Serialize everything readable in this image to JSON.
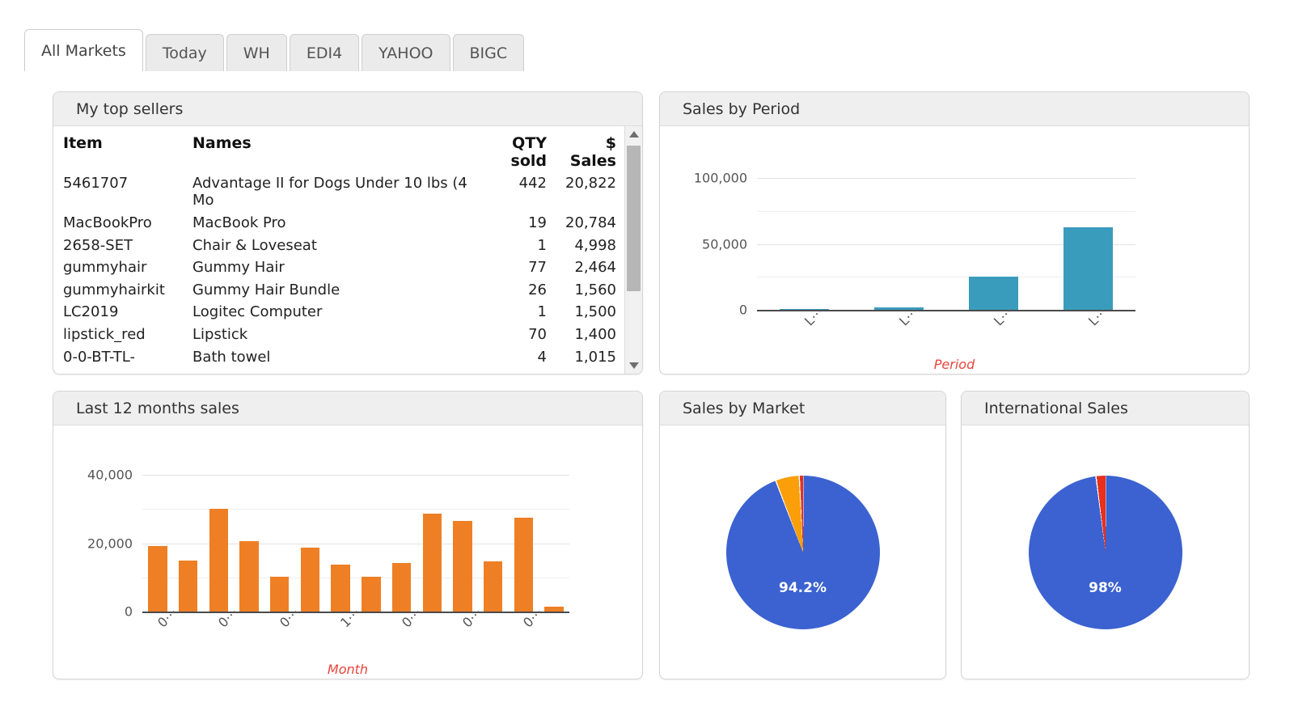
{
  "tabs": [
    {
      "label": "All Markets",
      "active": true
    },
    {
      "label": "Today",
      "active": false
    },
    {
      "label": "WH",
      "active": false
    },
    {
      "label": "EDI4",
      "active": false
    },
    {
      "label": "YAHOO",
      "active": false
    },
    {
      "label": "BIGC",
      "active": false
    }
  ],
  "panels": {
    "top_sellers": {
      "title": "My top sellers"
    },
    "sales_by_period": {
      "title": "Sales by Period"
    },
    "last_12_months": {
      "title": "Last 12 months sales"
    },
    "sales_by_market": {
      "title": "Sales by Market"
    },
    "international_sales": {
      "title": "International Sales"
    }
  },
  "top_sellers_table": {
    "columns": [
      "Item",
      "Names",
      "QTY sold",
      "$ Sales"
    ],
    "column_parts": {
      "qty_line1": "QTY",
      "qty_line2": "sold",
      "sales_line1": "$",
      "sales_line2": "Sales"
    },
    "rows": [
      {
        "item": "5461707",
        "name": "Advantage II for Dogs Under 10 lbs (4 Mo",
        "qty": "442",
        "sales": "20,822"
      },
      {
        "item": "MacBookPro",
        "name": "MacBook Pro",
        "qty": "19",
        "sales": "20,784"
      },
      {
        "item": "2658-SET",
        "name": "Chair & Loveseat",
        "qty": "1",
        "sales": "4,998"
      },
      {
        "item": "gummyhair",
        "name": "Gummy Hair",
        "qty": "77",
        "sales": "2,464"
      },
      {
        "item": "gummyhairkit",
        "name": "Gummy Hair Bundle",
        "qty": "26",
        "sales": "1,560"
      },
      {
        "item": "LC2019",
        "name": "Logitec Computer",
        "qty": "1",
        "sales": "1,500"
      },
      {
        "item": "lipstick_red",
        "name": "Lipstick",
        "qty": "70",
        "sales": "1,400"
      },
      {
        "item": "0-0-BT-TL-",
        "name": "Bath towel",
        "qty": "4",
        "sales": "1,015"
      }
    ],
    "scrollbar": {
      "up_icon": "triangle-up-icon",
      "down_icon": "triangle-down-icon"
    }
  },
  "colors": {
    "bar_teal": "#3a9cbc",
    "bar_orange": "#ef7f25",
    "pie_blue": "#3b62d0",
    "pie_orange": "#fa9e0a",
    "pie_red": "#e8301b",
    "axis_title": "#e8453c",
    "gridline": "#e3e3e3"
  },
  "chart_data": [
    {
      "id": "sales_by_period",
      "type": "bar",
      "title": "Sales by Period",
      "xlabel": "Period",
      "ylabel": "",
      "categories": [
        "L⋯",
        "L⋯",
        "L⋯",
        "L⋯"
      ],
      "values": [
        150,
        2100,
        25200,
        63000
      ],
      "yticks": [
        0,
        50000,
        100000
      ],
      "ytick_labels": [
        "0",
        "50,000",
        "100,000"
      ],
      "ylim": [
        0,
        115000
      ],
      "grid": true,
      "legend": "none",
      "series_color": "#3a9cbc"
    },
    {
      "id": "last_12_months_sales",
      "type": "bar",
      "title": "Last 12 months sales",
      "xlabel": "Month",
      "ylabel": "",
      "categories": [
        "0⋯",
        "",
        "0⋯",
        "",
        "0⋯",
        "",
        "1⋯",
        "",
        "0⋯",
        "",
        "0⋯",
        "",
        "0⋯",
        ""
      ],
      "values": [
        19100,
        15000,
        30200,
        20500,
        10200,
        18700,
        13700,
        10100,
        14200,
        28600,
        26600,
        14700,
        27500,
        1400
      ],
      "yticks": [
        0,
        20000,
        40000
      ],
      "ytick_labels": [
        "0",
        "20,000",
        "40,000"
      ],
      "ylim": [
        0,
        45000
      ],
      "grid": true,
      "legend": "none",
      "series_color": "#ef7f25"
    },
    {
      "id": "sales_by_market",
      "type": "pie",
      "title": "Sales by Market",
      "slices": [
        {
          "label": "94.2%",
          "value": 94.2,
          "color": "#3b62d0"
        },
        {
          "label": "",
          "value": 5.0,
          "color": "#fa9e0a"
        },
        {
          "label": "",
          "value": 0.8,
          "color": "#e8301b"
        }
      ],
      "visible_label": "94.2%",
      "legend": "none"
    },
    {
      "id": "international_sales",
      "type": "pie",
      "title": "International Sales",
      "slices": [
        {
          "label": "98%",
          "value": 98.0,
          "color": "#3b62d0"
        },
        {
          "label": "",
          "value": 2.0,
          "color": "#e8301b"
        }
      ],
      "visible_label": "98%",
      "legend": "none"
    }
  ]
}
